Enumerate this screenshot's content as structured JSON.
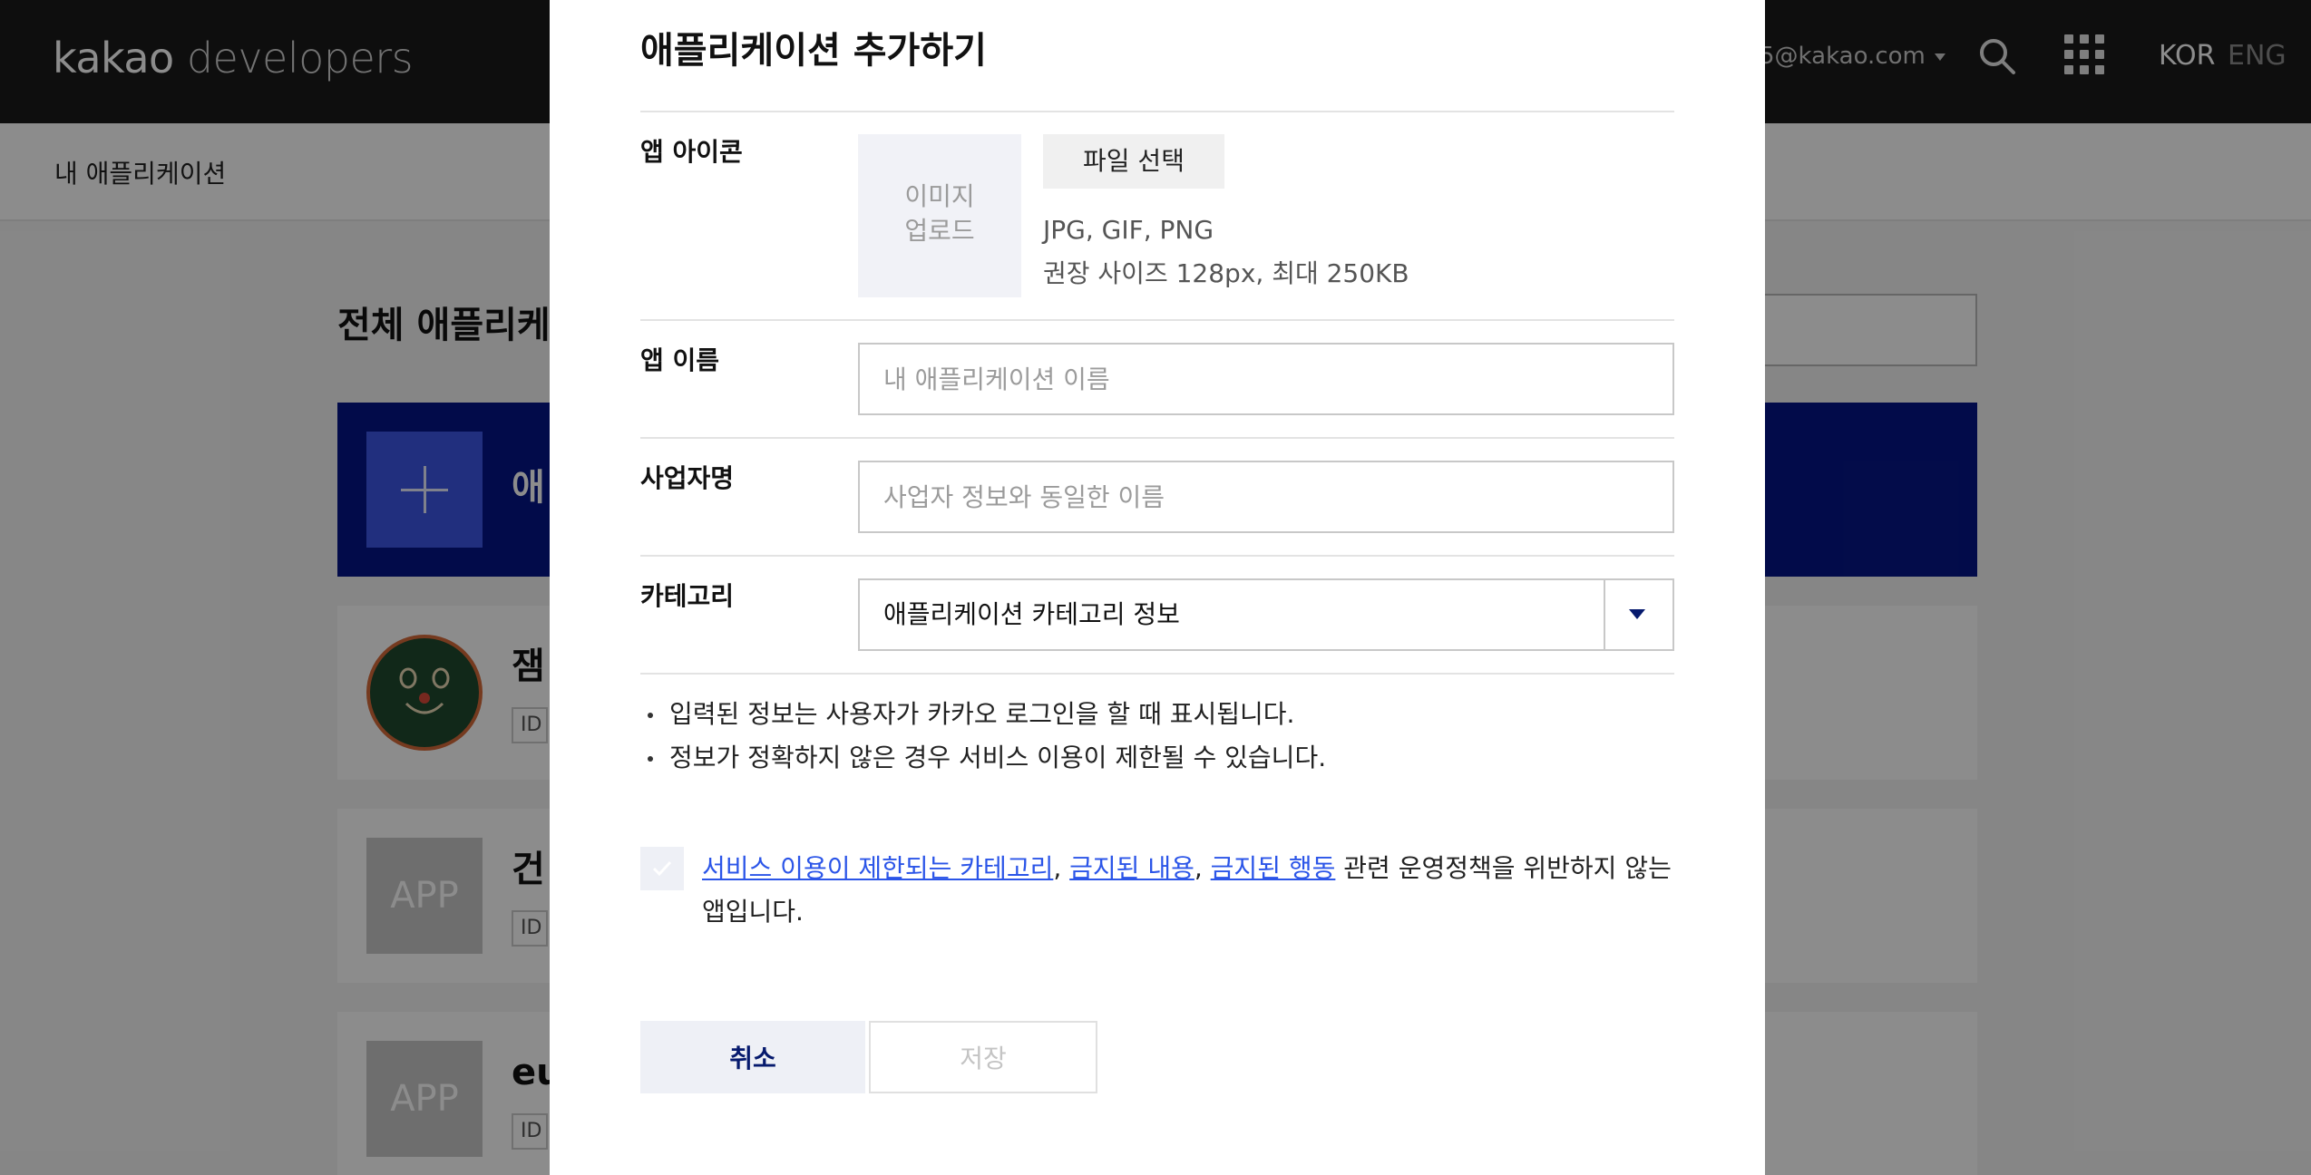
{
  "header": {
    "logo_primary": "kakao",
    "logo_secondary": "developers",
    "account_email": "5@kakao.com",
    "lang_kor": "KOR",
    "lang_eng": "ENG"
  },
  "subnav": {
    "my_apps": "내 애플리케이션"
  },
  "content": {
    "title": "전체 애플리케",
    "add_card_label": "애",
    "apps": [
      {
        "name": "잼",
        "id_label": "ID"
      },
      {
        "name": "건",
        "id_label": "ID",
        "thumb": "APP"
      },
      {
        "name": "eu",
        "id_label": "ID",
        "thumb": "APP"
      }
    ]
  },
  "modal": {
    "title": "애플리케이션 추가하기",
    "icon_row": {
      "label": "앱 아이콘",
      "upload_line1": "이미지",
      "upload_line2": "업로드",
      "file_button": "파일 선택",
      "hint_formats": "JPG, GIF, PNG",
      "hint_size": "권장 사이즈 128px, 최대 250KB"
    },
    "name_row": {
      "label": "앱 이름",
      "placeholder": "내 애플리케이션 이름",
      "value": ""
    },
    "company_row": {
      "label": "사업자명",
      "placeholder": "사업자 정보와 동일한 이름",
      "value": ""
    },
    "category_row": {
      "label": "카테고리",
      "selected": "애플리케이션 카테고리 정보"
    },
    "notices": [
      "입력된 정보는 사용자가 카카오 로그인을 할 때 표시됩니다.",
      "정보가 정확하지 않은 경우 서비스 이용이 제한될 수 있습니다."
    ],
    "agreement": {
      "link1": "서비스 이용이 제한되는 카테고리",
      "sep1": ", ",
      "link2": "금지된 내용",
      "sep2": ", ",
      "link3": "금지된 행동",
      "rest": " 관련 운영정책을 위반하지 않는 앱입니다.",
      "checked": false
    },
    "cancel_label": "취소",
    "save_label": "저장"
  },
  "colors": {
    "brand_navy": "#061a6e",
    "add_card_blue": "#051587",
    "link_blue": "#2b55e8",
    "header_dark": "#1a1a1a"
  }
}
